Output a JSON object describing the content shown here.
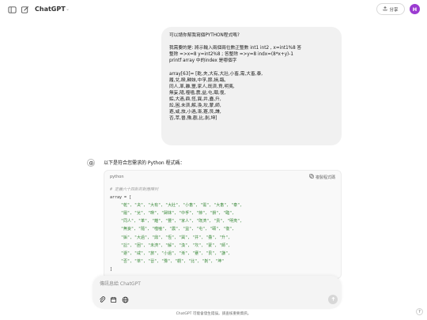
{
  "header": {
    "model_name": "ChatGPT",
    "share_label": "分享",
    "avatar_initial": "H",
    "avatar_color": "#9b3bd1",
    "icons": [
      "sidebar-toggle-icon",
      "new-chat-icon",
      "chevron-down-icon",
      "share-icon"
    ]
  },
  "user_message": {
    "lines": [
      "可以請你幫我寫個PYTHON程式嗎?",
      "",
      "我需要的是: 將示輸入兩個兩位數正整數 int1 int2 ,  x=int1%8 答",
      "整除 =>x=8  y=int2%8 ; 答整除 =>y=8   indx=(8*x+y)-1",
      "printf array 中的index 是哪個字",
      "",
      "array[63]= [乾,夬,大有,大壯,小畜,需,大畜,泰,",
      "履,兌,睽,歸妹,中孚,節,損,臨,",
      "同人,革,離,豐,家人,既濟,賁,明夷,",
      "無妄,隨,噬嗑,震,益,屯,頤,復,",
      "姤,大過,鼎,恆,巽,井,蠱,升,",
      "訟,困,未濟,解,渙,坎,蒙,師,",
      "遯,咸,旅,小過,漸,蹇,艮,謙,",
      "否,萃,晉,豫,觀,比,剝,坤]"
    ]
  },
  "assistant": {
    "intro": "以下是符合您需求的 Python 程式碼：",
    "code": {
      "language": "python",
      "copy_label": "複製程式碼",
      "comment": "# 定義六十四卦的對應陣列",
      "array_open": "array = [",
      "rows": [
        "\"乾\", \"夬\", \"大有\", \"大壯\", \"小畜\", \"需\", \"大畜\", \"泰\",",
        "\"履\", \"兌\", \"睽\", \"歸妹\", \"中孚\", \"節\", \"損\", \"臨\",",
        "\"同人\", \"革\", \"離\", \"豐\", \"家人\", \"既濟\", \"賁\", \"明夷\",",
        "\"無妄\", \"隨\", \"噬嗑\", \"震\", \"益\", \"屯\", \"頤\", \"復\",",
        "\"姤\", \"大過\", \"鼎\", \"恆\", \"巽\", \"井\", \"蠱\", \"升\",",
        "\"訟\", \"困\", \"未濟\", \"解\", \"渙\", \"坎\", \"蒙\", \"師\",",
        "\"遯\", \"咸\", \"旅\", \"小過\", \"漸\", \"蹇\", \"艮\", \"謙\",",
        "\"否\", \"萃\", \"晉\", \"豫\", \"觀\", \"比\", \"剝\", \"坤\""
      ],
      "array_close": "]"
    }
  },
  "composer": {
    "placeholder": "傳訊息給 ChatGPT",
    "icons": [
      "attach-icon",
      "tools-icon",
      "globe-icon",
      "send-arrow-icon"
    ]
  },
  "footer": {
    "note": "ChatGPT 可能會發生錯誤。請查核重要資訊。",
    "help_label": "?"
  }
}
